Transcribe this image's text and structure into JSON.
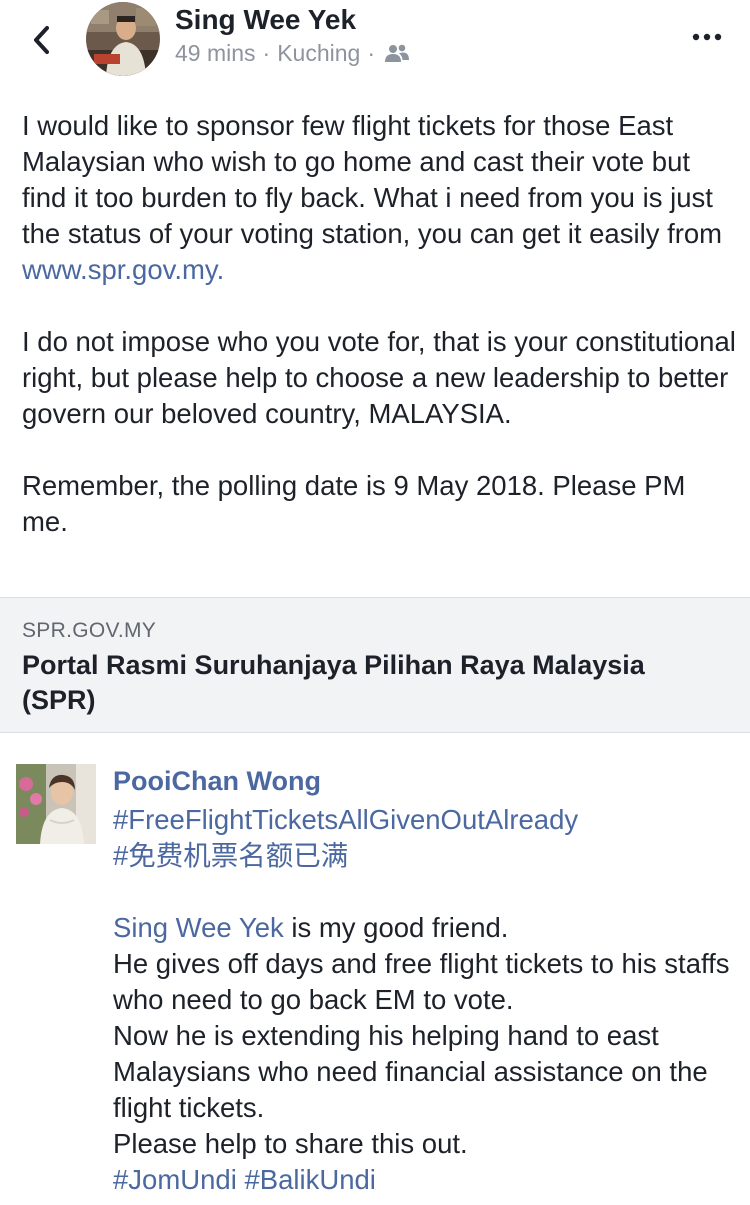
{
  "post": {
    "author": "Sing Wee Yek",
    "time": "49 mins",
    "location": "Kuching",
    "separator": "·",
    "privacy_icon": "friends-icon",
    "paragraph1_text": "I would like to sponsor few flight tickets for those East Malaysian who wish to go home and cast their vote but find it too burden to fly back. What i need from you is just the status of your voting station, you can get it easily from ",
    "paragraph1_link": "www.spr.gov.my",
    "paragraph1_end": ".",
    "paragraph2": "I do not impose who you vote for, that is your constitutional right, but please help to choose a new leadership to better govern our beloved country, MALAYSIA.",
    "paragraph3": "Remember, the polling date is 9 May 2018. Please PM me."
  },
  "link_preview": {
    "domain": "SPR.GOV.MY",
    "title": "Portal Rasmi Suruhanjaya Pilihan Raya Malaysia (SPR)"
  },
  "comment": {
    "author": "PooiChan Wong",
    "hashtag1": "#FreeFlightTicketsAllGivenOutAlready",
    "hashtag2": "#免费机票名额已满",
    "mention": "Sing Wee Yek",
    "mention_rest": " is my good friend.",
    "line2": "He gives off days and free flight tickets to his staffs who need to go back EM to vote.",
    "line3": "Now he is extending his helping hand to east Malaysians who need financial assistance on the flight tickets.",
    "line4": "Please help to share this out.",
    "hashtag3": "#JomUndi",
    "hashtag4": "#BalikUndi"
  },
  "colors": {
    "link": "#4b68a0",
    "meta_text": "#8d949e",
    "card_background": "#f2f3f5",
    "text": "#1d2129"
  }
}
